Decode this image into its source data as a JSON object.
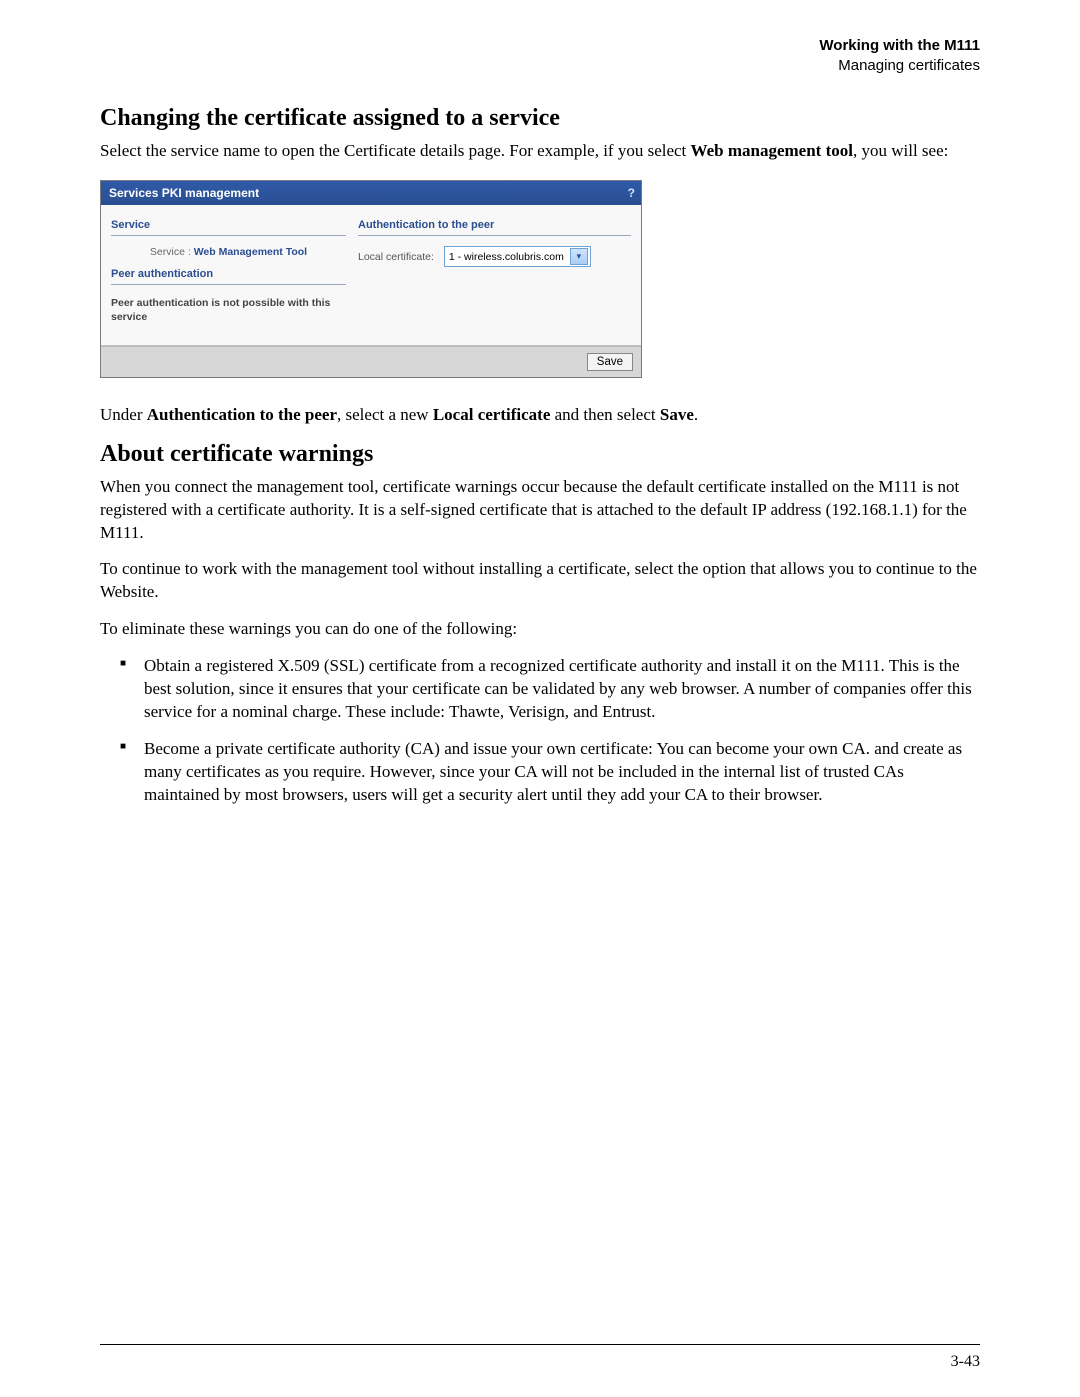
{
  "header": {
    "chapter": "Working with the M111",
    "section": "Managing certificates"
  },
  "sections": {
    "changing": {
      "title": "Changing the certificate assigned to a service",
      "intro_pre": "Select the service name to open the Certificate details page. For example, if you select ",
      "intro_bold1": "Web management tool",
      "intro_post": ", you will see:",
      "under_pre": "Under ",
      "under_bold1": "Authentication to the peer",
      "under_mid": ", select a new ",
      "under_bold2": "Local certificate",
      "under_mid2": " and then select ",
      "under_bold3": "Save",
      "under_post": "."
    },
    "warnings": {
      "title": "About certificate warnings",
      "p1": "When you connect the management tool, certificate warnings occur because the default certificate installed on the M111 is not registered with a certificate authority. It is a self-signed certificate that is attached to the default IP address (192.168.1.1) for the M111.",
      "p2": "To continue to work with the management tool without installing a certificate, select the option that allows you to continue to the Website.",
      "p3": "To eliminate these warnings you can do one of the following:",
      "li1": "Obtain a registered X.509 (SSL) certificate from a recognized certificate authority and install it on the M111. This is the best solution, since it ensures that your certificate can be validated by any web browser. A number of companies offer this service for a nominal charge. These include: Thawte, Verisign, and Entrust.",
      "li2": "Become a private certificate authority (CA) and issue your own certificate: You can become your own CA. and create as many certificates as you require. However, since your CA will not be included in the internal list of trusted CAs maintained by most browsers, users will get a security alert until they add your CA to their browser."
    }
  },
  "screenshot": {
    "title": "Services PKI management",
    "help": "?",
    "service_header": "Service",
    "service_label": "Service :",
    "service_name": "Web Management Tool",
    "auth_header": "Authentication to the peer",
    "local_cert_label": "Local certificate:",
    "local_cert_value": "1 - wireless.colubris.com",
    "peer_auth_header": "Peer authentication",
    "peer_auth_msg": "Peer authentication is not possible with this service",
    "save_label": "Save"
  },
  "footer": {
    "page_number": "3-43"
  }
}
